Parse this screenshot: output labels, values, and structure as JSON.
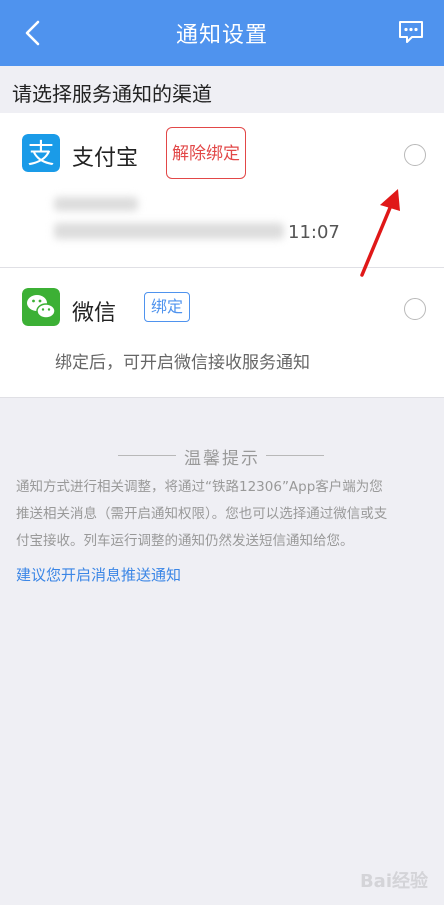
{
  "header": {
    "title": "通知设置",
    "back_icon": "chevron-left-icon",
    "message_icon": "message-dots-icon",
    "bg_color": "#4f93ee"
  },
  "section_title": "请选择服务通知的渠道",
  "channels": [
    {
      "name": "支付宝",
      "icon": "alipay-icon",
      "action_label": "解除绑定",
      "bind_time_visible": "11:07",
      "selected": false,
      "action_color": "#e24848"
    },
    {
      "name": "微信",
      "icon": "wechat-icon",
      "action_label": "绑定",
      "description": "绑定后，可开启微信接收服务通知",
      "selected": false,
      "action_color": "#4f93ee"
    }
  ],
  "tips": {
    "title": "温馨提示",
    "body": "通知方式进行相关调整，将通过“铁路12306”App客户端为您推送相关消息（需开启通知权限）。您也可以选择通过微信或支付宝接收。列车运行调整的通知仍然发送短信通知给您。",
    "link": "建议您开启消息推送通知"
  },
  "watermark": "Bai经验"
}
